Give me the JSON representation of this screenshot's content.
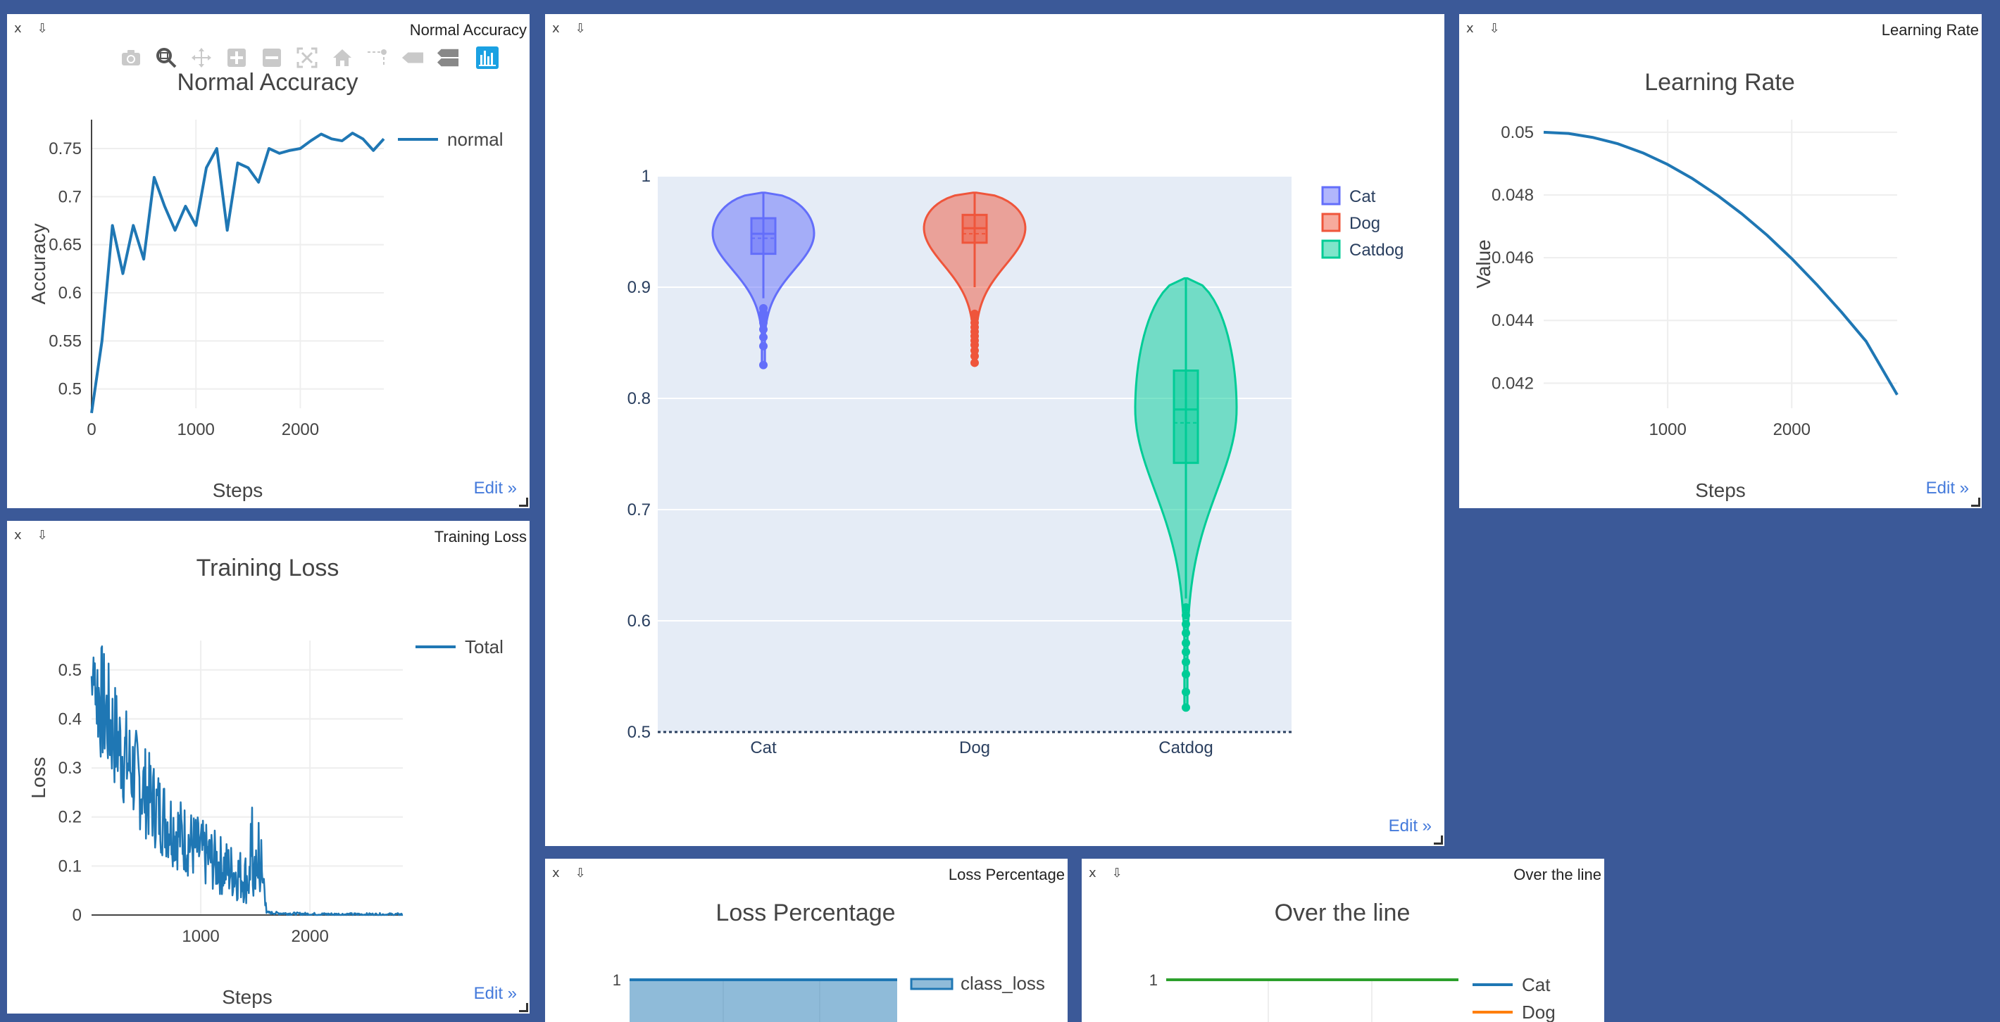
{
  "panes": {
    "normal_accuracy": {
      "window_title": "Normal Accuracy",
      "close": "x",
      "pin": "⇩",
      "edit": "Edit »"
    },
    "violin": {
      "window_title": "",
      "close": "x",
      "pin": "⇩",
      "edit": "Edit »"
    },
    "learning_rate": {
      "window_title": "Learning Rate",
      "close": "x",
      "pin": "⇩",
      "edit": "Edit »"
    },
    "training_loss": {
      "window_title": "Training Loss",
      "close": "x",
      "pin": "⇩",
      "edit": "Edit »"
    },
    "loss_percentage": {
      "window_title": "Loss Percentage",
      "close": "x",
      "pin": "⇩"
    },
    "over_the_line": {
      "window_title": "Over the line",
      "close": "x",
      "pin": "⇩"
    }
  },
  "modebar": {
    "icons": [
      "camera-icon",
      "zoom-icon",
      "pan-icon",
      "zoom-in-icon",
      "zoom-out-icon",
      "autoscale-icon",
      "home-icon",
      "spike-lines-icon",
      "hover-closest-icon",
      "hover-compare-icon",
      "plotly-logo-icon"
    ],
    "accent": "#1ba1e2"
  },
  "chart_data": [
    {
      "id": "normal_accuracy",
      "type": "line",
      "title": "Normal Accuracy",
      "xlabel": "Steps",
      "ylabel": "Accuracy",
      "xlim": [
        0,
        2800
      ],
      "ylim": [
        0.48,
        0.78
      ],
      "xticks": [
        0,
        1000,
        2000
      ],
      "xtick_labels": [
        "0",
        "1000",
        "2000"
      ],
      "yticks": [
        0.5,
        0.55,
        0.6,
        0.65,
        0.7,
        0.75
      ],
      "ytick_labels": [
        "0.5",
        "0.55",
        "0.6",
        "0.65",
        "0.7",
        "0.75"
      ],
      "legend_position": "right",
      "series": [
        {
          "name": "normal",
          "color": "#1f77b4",
          "x": [
            0,
            100,
            200,
            300,
            400,
            500,
            600,
            700,
            800,
            900,
            1000,
            1100,
            1200,
            1300,
            1400,
            1500,
            1600,
            1700,
            1800,
            1900,
            2000,
            2100,
            2200,
            2300,
            2400,
            2500,
            2600,
            2700,
            2800
          ],
          "y": [
            0.475,
            0.55,
            0.67,
            0.62,
            0.67,
            0.635,
            0.72,
            0.69,
            0.665,
            0.69,
            0.67,
            0.73,
            0.75,
            0.665,
            0.735,
            0.73,
            0.715,
            0.75,
            0.745,
            0.748,
            0.75,
            0.758,
            0.765,
            0.76,
            0.758,
            0.766,
            0.76,
            0.748,
            0.76
          ]
        }
      ]
    },
    {
      "id": "violin",
      "type": "violin",
      "title": "",
      "xlabel": "",
      "ylabel": "",
      "ylim": [
        0.5,
        1.0
      ],
      "yticks": [
        0.5,
        0.6,
        0.7,
        0.8,
        0.9,
        1.0
      ],
      "ytick_labels": [
        "0.5",
        "0.6",
        "0.7",
        "0.8",
        "0.9",
        "1"
      ],
      "categories": [
        "Cat",
        "Dog",
        "Catdog"
      ],
      "legend_position": "top-right",
      "series": [
        {
          "name": "Cat",
          "color": "#636efa",
          "min": 0.83,
          "q1": 0.93,
          "median": 0.948,
          "mean": 0.944,
          "q3": 0.962,
          "max": 0.985,
          "whisker_low": 0.89,
          "outliers": [
            0.83,
            0.847,
            0.855,
            0.862,
            0.868,
            0.873,
            0.877,
            0.881
          ]
        },
        {
          "name": "Dog",
          "color": "#ef553b",
          "min": 0.832,
          "q1": 0.94,
          "median": 0.953,
          "mean": 0.948,
          "q3": 0.965,
          "max": 0.985,
          "whisker_low": 0.9,
          "outliers": [
            0.832,
            0.838,
            0.843,
            0.848,
            0.852,
            0.856,
            0.86,
            0.864,
            0.868,
            0.872,
            0.876
          ]
        },
        {
          "name": "Catdog",
          "color": "#00cc96",
          "min": 0.522,
          "q1": 0.742,
          "median": 0.79,
          "mean": 0.778,
          "q3": 0.825,
          "max": 0.908,
          "whisker_low": 0.62,
          "outliers": [
            0.522,
            0.536,
            0.552,
            0.563,
            0.572,
            0.58,
            0.589,
            0.597,
            0.605,
            0.612
          ]
        }
      ]
    },
    {
      "id": "learning_rate",
      "type": "line",
      "title": "Learning Rate",
      "xlabel": "Steps",
      "ylabel": "Value",
      "xlim": [
        0,
        2850
      ],
      "ylim": [
        0.0412,
        0.0504
      ],
      "xticks": [
        1000,
        2000
      ],
      "xtick_labels": [
        "1000",
        "2000"
      ],
      "yticks": [
        0.042,
        0.044,
        0.046,
        0.048,
        0.05
      ],
      "ytick_labels": [
        "0.042",
        "0.044",
        "0.046",
        "0.048",
        "0.05"
      ],
      "series": [
        {
          "name": "",
          "color": "#1f77b4",
          "x": [
            0,
            200,
            400,
            600,
            800,
            1000,
            1200,
            1400,
            1600,
            1800,
            2000,
            2200,
            2400,
            2600,
            2850
          ],
          "y": [
            0.05,
            0.04996,
            0.04983,
            0.04963,
            0.04934,
            0.04897,
            0.04852,
            0.04799,
            0.04739,
            0.04672,
            0.04597,
            0.04515,
            0.04427,
            0.04333,
            0.04163
          ]
        }
      ]
    },
    {
      "id": "training_loss",
      "type": "line",
      "title": "Training Loss",
      "xlabel": "Steps",
      "ylabel": "Loss",
      "xlim": [
        0,
        2850
      ],
      "ylim": [
        0,
        0.56
      ],
      "xticks": [
        1000,
        2000
      ],
      "xtick_labels": [
        "1000",
        "2000"
      ],
      "yticks": [
        0,
        0.1,
        0.2,
        0.3,
        0.4,
        0.5
      ],
      "ytick_labels": [
        "0",
        "0.1",
        "0.2",
        "0.3",
        "0.4",
        "0.5"
      ],
      "legend_position": "top-right",
      "series": [
        {
          "name": "Total",
          "color": "#1f77b4"
        }
      ]
    },
    {
      "id": "loss_percentage",
      "type": "area",
      "title": "Loss Percentage",
      "xlabel": "",
      "ylabel": "",
      "yticks": [
        1
      ],
      "ytick_labels": [
        "1"
      ],
      "legend_position": "top-right",
      "series": [
        {
          "name": "class_loss",
          "color": "#1f77b4",
          "x": [
            0,
            1
          ],
          "y": [
            1,
            1
          ]
        }
      ]
    },
    {
      "id": "over_the_line",
      "type": "line",
      "title": "Over the line",
      "xlabel": "",
      "ylabel": "",
      "yticks": [
        1
      ],
      "ytick_labels": [
        "1"
      ],
      "legend_position": "top-right",
      "series": [
        {
          "name": "Cat",
          "color": "#1f77b4",
          "x": [
            0,
            1
          ],
          "y": [
            1,
            1
          ]
        },
        {
          "name": "Dog",
          "color": "#ff7f0e",
          "x": [
            0,
            1
          ],
          "y": [
            1,
            1
          ]
        },
        {
          "name": "",
          "color": "#2ca02c",
          "x": [
            0,
            1
          ],
          "y": [
            1,
            1
          ]
        }
      ]
    }
  ]
}
